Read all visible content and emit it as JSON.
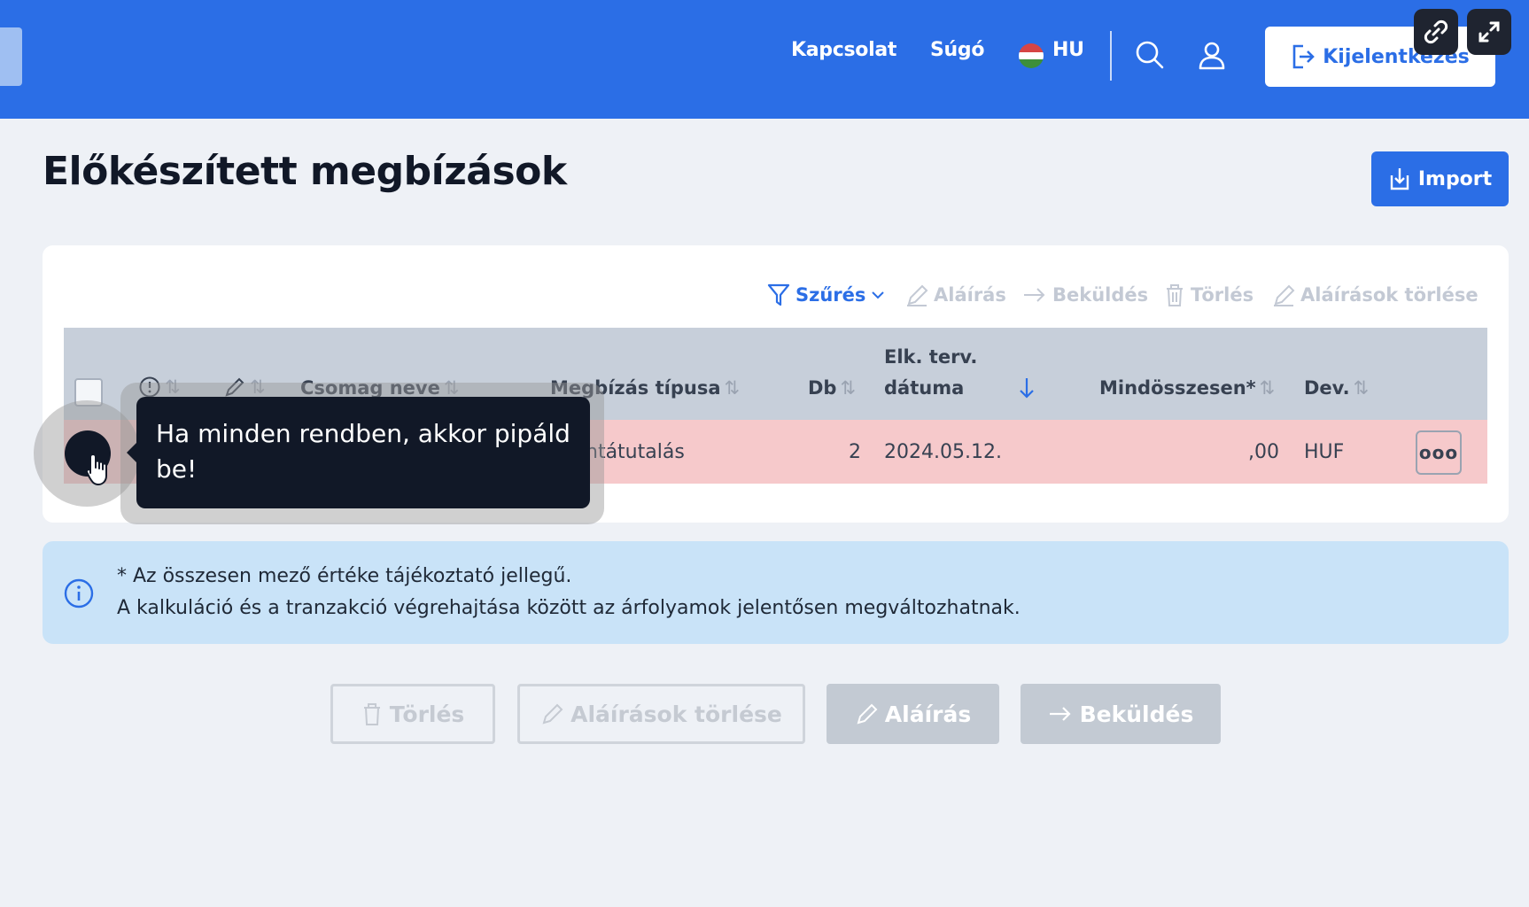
{
  "header": {
    "nav": [
      "Kapcsolat",
      "Súgó"
    ],
    "language": "HU",
    "logout_label": "Kijelentkezés",
    "icons": [
      "search-icon",
      "user-icon",
      "logout-icon",
      "link-icon",
      "expand-icon"
    ]
  },
  "page": {
    "title": "Előkészített megbízások",
    "import_label": "Import"
  },
  "toolbar": {
    "filter_label": "Szűrés",
    "sign_label": "Aláírás",
    "submit_label": "Beküldés",
    "delete_label": "Törlés",
    "delete_signatures_label": "Aláírások törlése"
  },
  "table": {
    "columns": {
      "package_name": "Csomag neve",
      "order_type": "Megbízás típusa",
      "count": "Db",
      "date_line1": "Elk. terv.",
      "date_line2": "dátuma",
      "total": "Mindösszesen*",
      "currency": "Dev."
    },
    "rows": [
      {
        "order_type": "ntátutalás",
        "count": "2",
        "date": "2024.05.12.",
        "total": ",00",
        "currency": "HUF",
        "more": "ooo"
      }
    ]
  },
  "tooltip": {
    "text": "Ha minden rendben, akkor pipáld be!"
  },
  "info": {
    "line1": "* Az összesen mező értéke tájékoztató jellegű.",
    "line2": "A kalkuláció és a tranzakció végrehajtása között az árfolyamok jelentősen megváltozhatnak."
  },
  "actions": {
    "delete_label": "Törlés",
    "delete_signatures_label": "Aláírások törlése",
    "sign_label": "Aláírás",
    "submit_label": "Beküldés"
  },
  "colors": {
    "primary": "#2b6ee6",
    "row_highlight": "#f6c9cb",
    "info_bg": "#c9e3f8",
    "tooltip_bg": "#111827"
  }
}
